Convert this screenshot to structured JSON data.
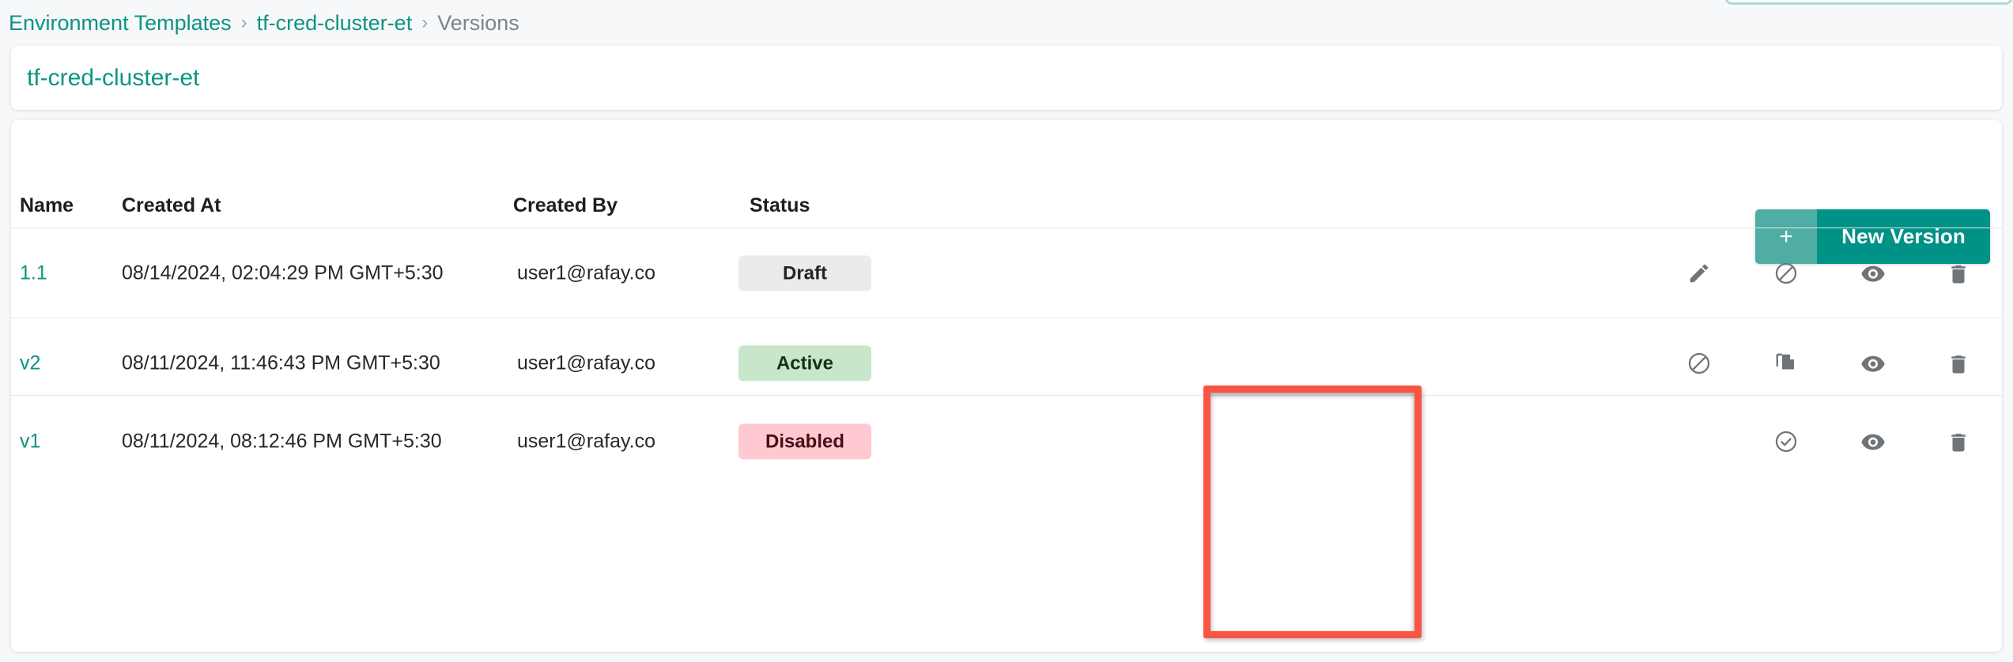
{
  "breadcrumb": {
    "items": [
      {
        "label": "Environment Templates",
        "type": "link"
      },
      {
        "label": "tf-cred-cluster-et",
        "type": "link"
      },
      {
        "label": "Versions",
        "type": "current"
      }
    ],
    "separator": "›"
  },
  "header": {
    "title": "tf-cred-cluster-et"
  },
  "toolbar": {
    "new_version_plus": "+",
    "new_version_label": "New Version"
  },
  "table": {
    "columns": [
      "Name",
      "Created At",
      "Created By",
      "Status"
    ],
    "rows": [
      {
        "name": "1.1",
        "created_at": "08/14/2024, 02:04:29 PM GMT+5:30",
        "created_by": "user1@rafay.co",
        "status": "Draft",
        "status_kind": "draft",
        "actions": [
          "edit-icon",
          "disable-icon",
          "view-icon",
          "delete-icon"
        ]
      },
      {
        "name": "v2",
        "created_at": "08/11/2024, 11:46:43 PM GMT+5:30",
        "created_by": "user1@rafay.co",
        "status": "Active",
        "status_kind": "active",
        "actions": [
          "disable-icon",
          "duplicate-icon",
          "view-icon",
          "delete-icon"
        ]
      },
      {
        "name": "v1",
        "created_at": "08/11/2024, 08:12:46 PM GMT+5:30",
        "created_by": "user1@rafay.co",
        "status": "Disabled",
        "status_kind": "disabled",
        "actions": [
          "",
          "enable-icon",
          "view-icon",
          "delete-icon"
        ]
      }
    ]
  },
  "annotation": {
    "highlight_color": "#fa5542",
    "target": "status-column"
  },
  "colors": {
    "brand_teal": "#0e9384",
    "button_teal": "#009286",
    "button_teal_light": "#4fada4",
    "page_background": "#f6f8f9",
    "badge_draft_bg": "#ebebeb",
    "badge_active_bg": "#c8e6c9",
    "badge_disabled_bg": "#ffc9d1"
  }
}
